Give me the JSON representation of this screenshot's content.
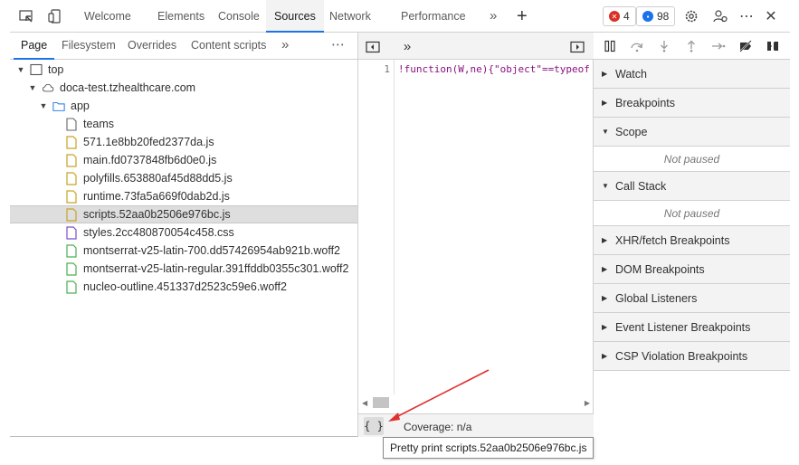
{
  "toolbar": {
    "tabs": [
      "Welcome",
      "Elements",
      "Console",
      "Sources",
      "Network",
      "Performance"
    ],
    "more": "»",
    "add": "+",
    "errors_count": "4",
    "messages_count": "98",
    "more_options": "⋯",
    "close": "✕"
  },
  "navigator": {
    "tabs": [
      "Page",
      "Filesystem",
      "Overrides",
      "Content scripts"
    ],
    "more": "»",
    "menu": "⋯",
    "tree": [
      {
        "label": "top",
        "type": "frame"
      },
      {
        "label": "doca-test.tzhealthcare.com",
        "type": "cloud"
      },
      {
        "label": "app",
        "type": "folder"
      },
      {
        "label": "teams",
        "type": "file"
      },
      {
        "label": "571.1e8bb20fed2377da.js",
        "type": "js"
      },
      {
        "label": "main.fd0737848fb6d0e0.js",
        "type": "js"
      },
      {
        "label": "polyfills.653880af45d88dd5.js",
        "type": "js"
      },
      {
        "label": "runtime.73fa5a669f0dab2d.js",
        "type": "js"
      },
      {
        "label": "scripts.52aa0b2506e976bc.js",
        "type": "js"
      },
      {
        "label": "styles.2cc480870054c458.css",
        "type": "css"
      },
      {
        "label": "montserrat-v25-latin-700.dd57426954ab921b.woff2",
        "type": "font"
      },
      {
        "label": "montserrat-v25-latin-regular.391ffddb0355c301.woff2",
        "type": "font"
      },
      {
        "label": "nucleo-outline.451337d2523c59e6.woff2",
        "type": "font"
      }
    ]
  },
  "editor": {
    "more": "»",
    "line_number": "1",
    "code": "!function(W,ne){\"object\"==typeof",
    "pretty_print": "{ }",
    "coverage": "Coverage: n/a"
  },
  "debugger": {
    "sections": [
      {
        "label": "Watch",
        "expanded": false
      },
      {
        "label": "Breakpoints",
        "expanded": false
      },
      {
        "label": "Scope",
        "expanded": true
      },
      {
        "label": "Call Stack",
        "expanded": true
      },
      {
        "label": "XHR/fetch Breakpoints",
        "expanded": false
      },
      {
        "label": "DOM Breakpoints",
        "expanded": false
      },
      {
        "label": "Global Listeners",
        "expanded": false
      },
      {
        "label": "Event Listener Breakpoints",
        "expanded": false
      },
      {
        "label": "CSP Violation Breakpoints",
        "expanded": false
      }
    ],
    "scope_status": "Not paused",
    "callstack_status": "Not paused"
  },
  "tooltip": "Pretty print scripts.52aa0b2506e976bc.js",
  "colors": {
    "accent": "#1a73e8",
    "error_badge": "#d93025",
    "info_badge": "#1a73e8",
    "js_file": "#c9a227",
    "css_file": "#7b4fc9",
    "font_file": "#4caf50",
    "annotation_arrow": "#e03131"
  }
}
